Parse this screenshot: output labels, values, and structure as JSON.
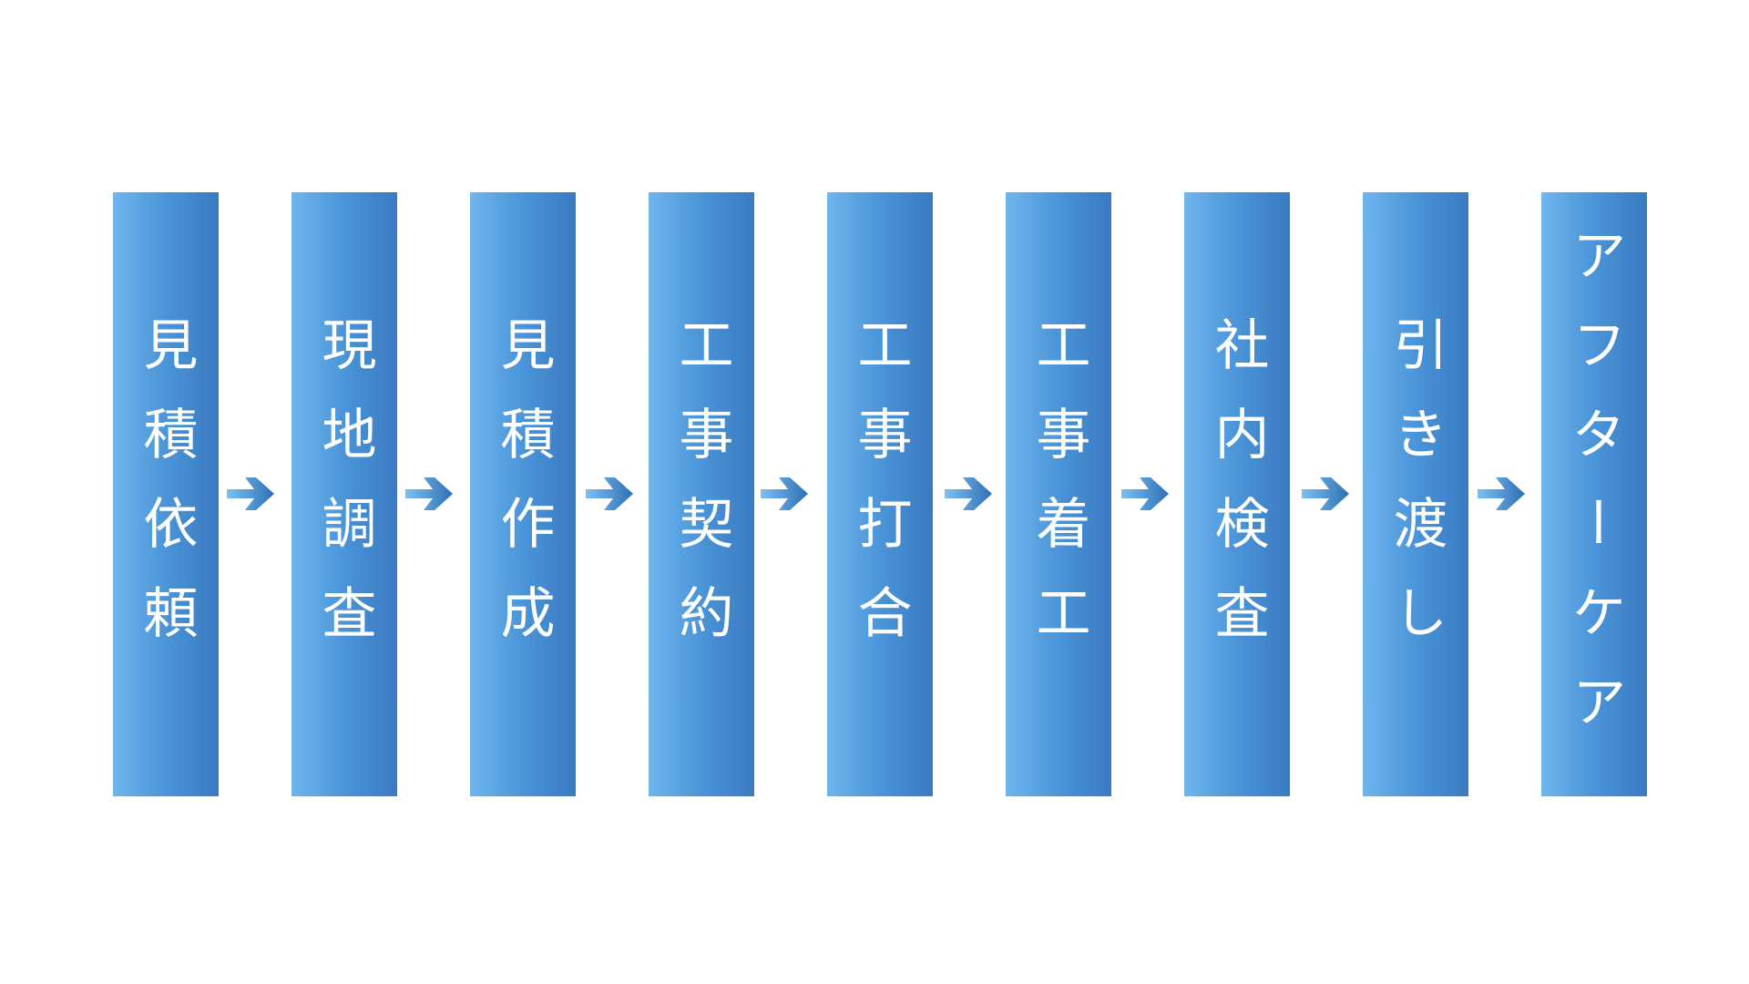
{
  "flow": {
    "steps": [
      {
        "label": "見積依頼"
      },
      {
        "label": "現地調査"
      },
      {
        "label": "見積作成"
      },
      {
        "label": "工事契約"
      },
      {
        "label": "工事打合"
      },
      {
        "label": "工事着工"
      },
      {
        "label": "社内検査"
      },
      {
        "label": "引き渡し"
      },
      {
        "label": "アフターケア"
      }
    ],
    "arrow_icon": "arrow-right-icon",
    "colors": {
      "box_light": "#6fb6ee",
      "box_mid": "#4a94d8",
      "box_dark": "#3a7ac0",
      "arrow_light": "#7cc0f2",
      "arrow_dark": "#2f6fb3",
      "text": "#ffffff",
      "background": "#ffffff"
    }
  }
}
